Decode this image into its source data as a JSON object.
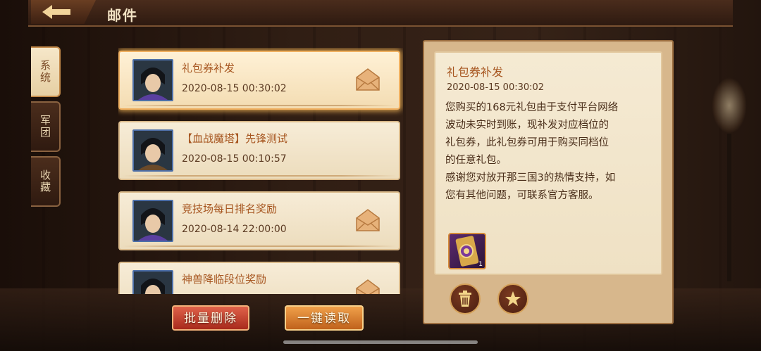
{
  "header": {
    "title": "邮件"
  },
  "side_tabs": [
    {
      "label": "系统",
      "active": true
    },
    {
      "label": "军团",
      "active": false
    },
    {
      "label": "收藏",
      "active": false
    }
  ],
  "mails": [
    {
      "title": "礼包券补发",
      "date": "2020-08-15 00:30:02",
      "has_envelope": true,
      "selected": true
    },
    {
      "title": "【血战魔塔】先锋测试",
      "date": "2020-08-15 00:10:57",
      "has_envelope": false,
      "selected": false
    },
    {
      "title": "竞技场每日排名奖励",
      "date": "2020-08-14 22:00:00",
      "has_envelope": true,
      "selected": false
    },
    {
      "title": "神兽降临段位奖励",
      "date": "",
      "has_envelope": true,
      "selected": false
    }
  ],
  "buttons": {
    "batch_delete": "批量删除",
    "read_all": "一键读取"
  },
  "detail": {
    "title": "礼包券补发",
    "date": "2020-08-15 00:30:02",
    "body": "您购买的168元礼包由于支付平台网络\n波动未实时到账，现补发对应档位的\n礼包券，此礼包券可用于购买同档位\n的任意礼包。\n感谢您对放开那三国3的热情支持，如\n您有其他问题，可联系官方客服。",
    "attachment": {
      "icon": "gift-voucher-icon",
      "count": "1"
    }
  },
  "colors": {
    "accent_orange": "#f0a04a",
    "title_brown": "#a6551f",
    "delete_red": "#a82a1c"
  }
}
